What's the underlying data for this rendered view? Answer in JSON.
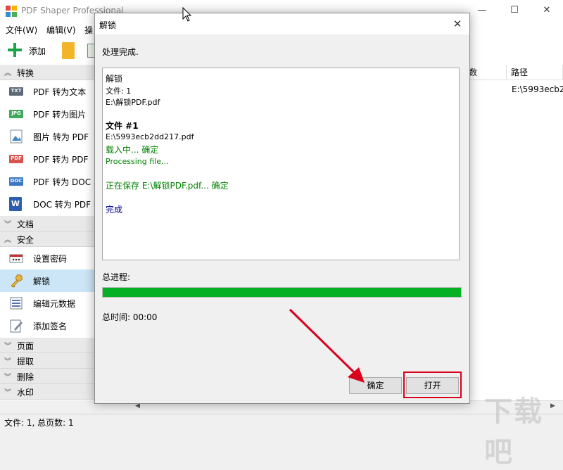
{
  "app": {
    "title": "PDF Shaper Professional",
    "window_controls": {
      "minimize": "—",
      "maximize": "☐",
      "close": "✕"
    }
  },
  "menu": [
    "文件(W)",
    "编辑(V)",
    "操"
  ],
  "toolbar": {
    "add_label": "添加"
  },
  "sidebar": {
    "categories": {
      "convert": "转换",
      "document": "文档",
      "security": "安全",
      "page": "页面",
      "extract": "提取",
      "delete": "删除",
      "watermark": "水印"
    },
    "convert_items": [
      {
        "label": "PDF 转为文本",
        "icon": "txt-icon",
        "badge": "TXT"
      },
      {
        "label": "PDF 转为图片",
        "icon": "jpg-icon",
        "badge": "JPG"
      },
      {
        "label": "图片 转为 PDF",
        "icon": "image-icon",
        "badge": ""
      },
      {
        "label": "PDF 转为 PDF",
        "icon": "pdf-icon",
        "badge": "PDF"
      },
      {
        "label": "PDF 转为 DOC",
        "icon": "doc-icon",
        "badge": "DOC"
      },
      {
        "label": "DOC 转为 PDF",
        "icon": "word-icon",
        "badge": "W"
      }
    ],
    "security_items": [
      {
        "label": "设置密码",
        "icon": "password-icon"
      },
      {
        "label": "解锁",
        "icon": "key-icon"
      },
      {
        "label": "编辑元数据",
        "icon": "metadata-icon"
      },
      {
        "label": "添加签名",
        "icon": "signature-icon"
      }
    ]
  },
  "list": {
    "columns": [
      "数",
      "路径"
    ],
    "rows": [
      {
        "path": "E:\\5993ecb2"
      }
    ]
  },
  "status_bar": "文件: 1, 总页数: 1",
  "dialog": {
    "title": "解锁",
    "status": "处理完成.",
    "log": [
      {
        "text": "解锁",
        "color": "#000000",
        "style": "normal"
      },
      {
        "text": "文件: 1",
        "color": "#000000",
        "style": "small"
      },
      {
        "text": "E:\\解锁PDF.pdf",
        "color": "#000000",
        "style": "small"
      },
      {
        "text": "文件 #1",
        "color": "#000000",
        "style": "bold"
      },
      {
        "text": "E:\\5993ecb2dd217.pdf",
        "color": "#000000",
        "style": "small"
      },
      {
        "text": "载入中... 确定",
        "color": "#008000",
        "style": "normal"
      },
      {
        "text": "Processing file...",
        "color": "#008000",
        "style": "small"
      },
      {
        "text": "正在保存 E:\\解锁PDF.pdf... 确定",
        "color": "#008000",
        "style": "normal"
      },
      {
        "text": "完成",
        "color": "#000080",
        "style": "normal"
      }
    ],
    "progress_label": "总进程:",
    "progress": 1.0,
    "progress_color": "#06b025",
    "time_label": "总时间: 00:00",
    "ok_label": "确定",
    "open_label": "打开"
  },
  "annotation_color": "#d9001b",
  "watermark": "下载吧"
}
